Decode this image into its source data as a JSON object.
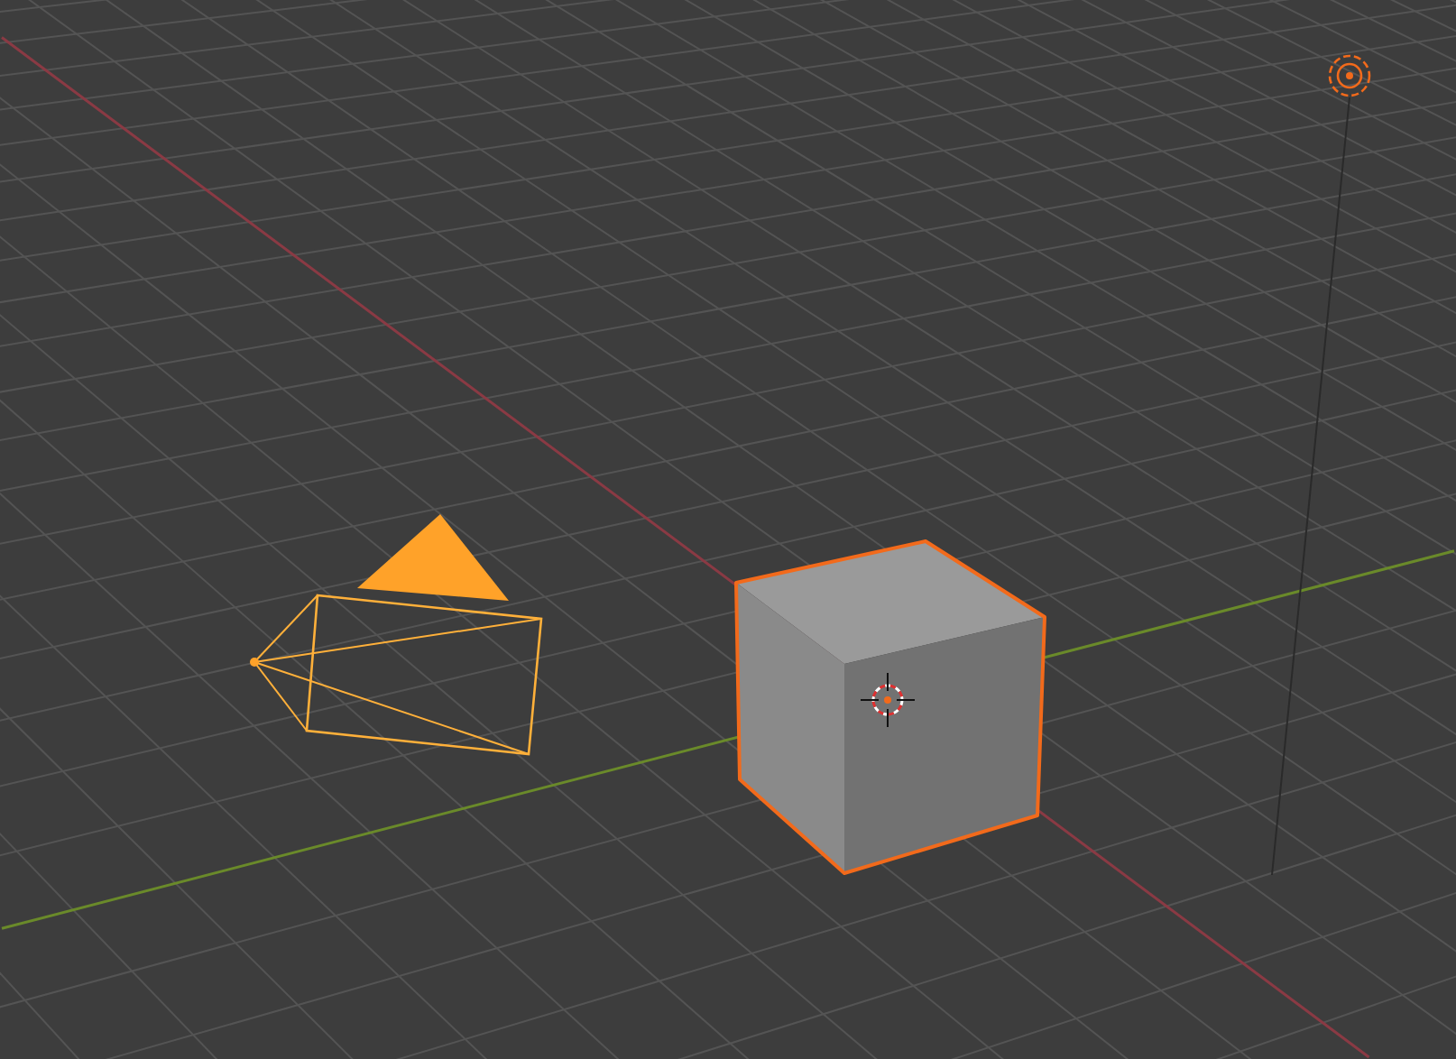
{
  "viewport": {
    "objects": [
      {
        "kind": "camera",
        "selected": true
      },
      {
        "kind": "cube",
        "selected": true
      },
      {
        "kind": "light",
        "selected": true
      }
    ]
  }
}
